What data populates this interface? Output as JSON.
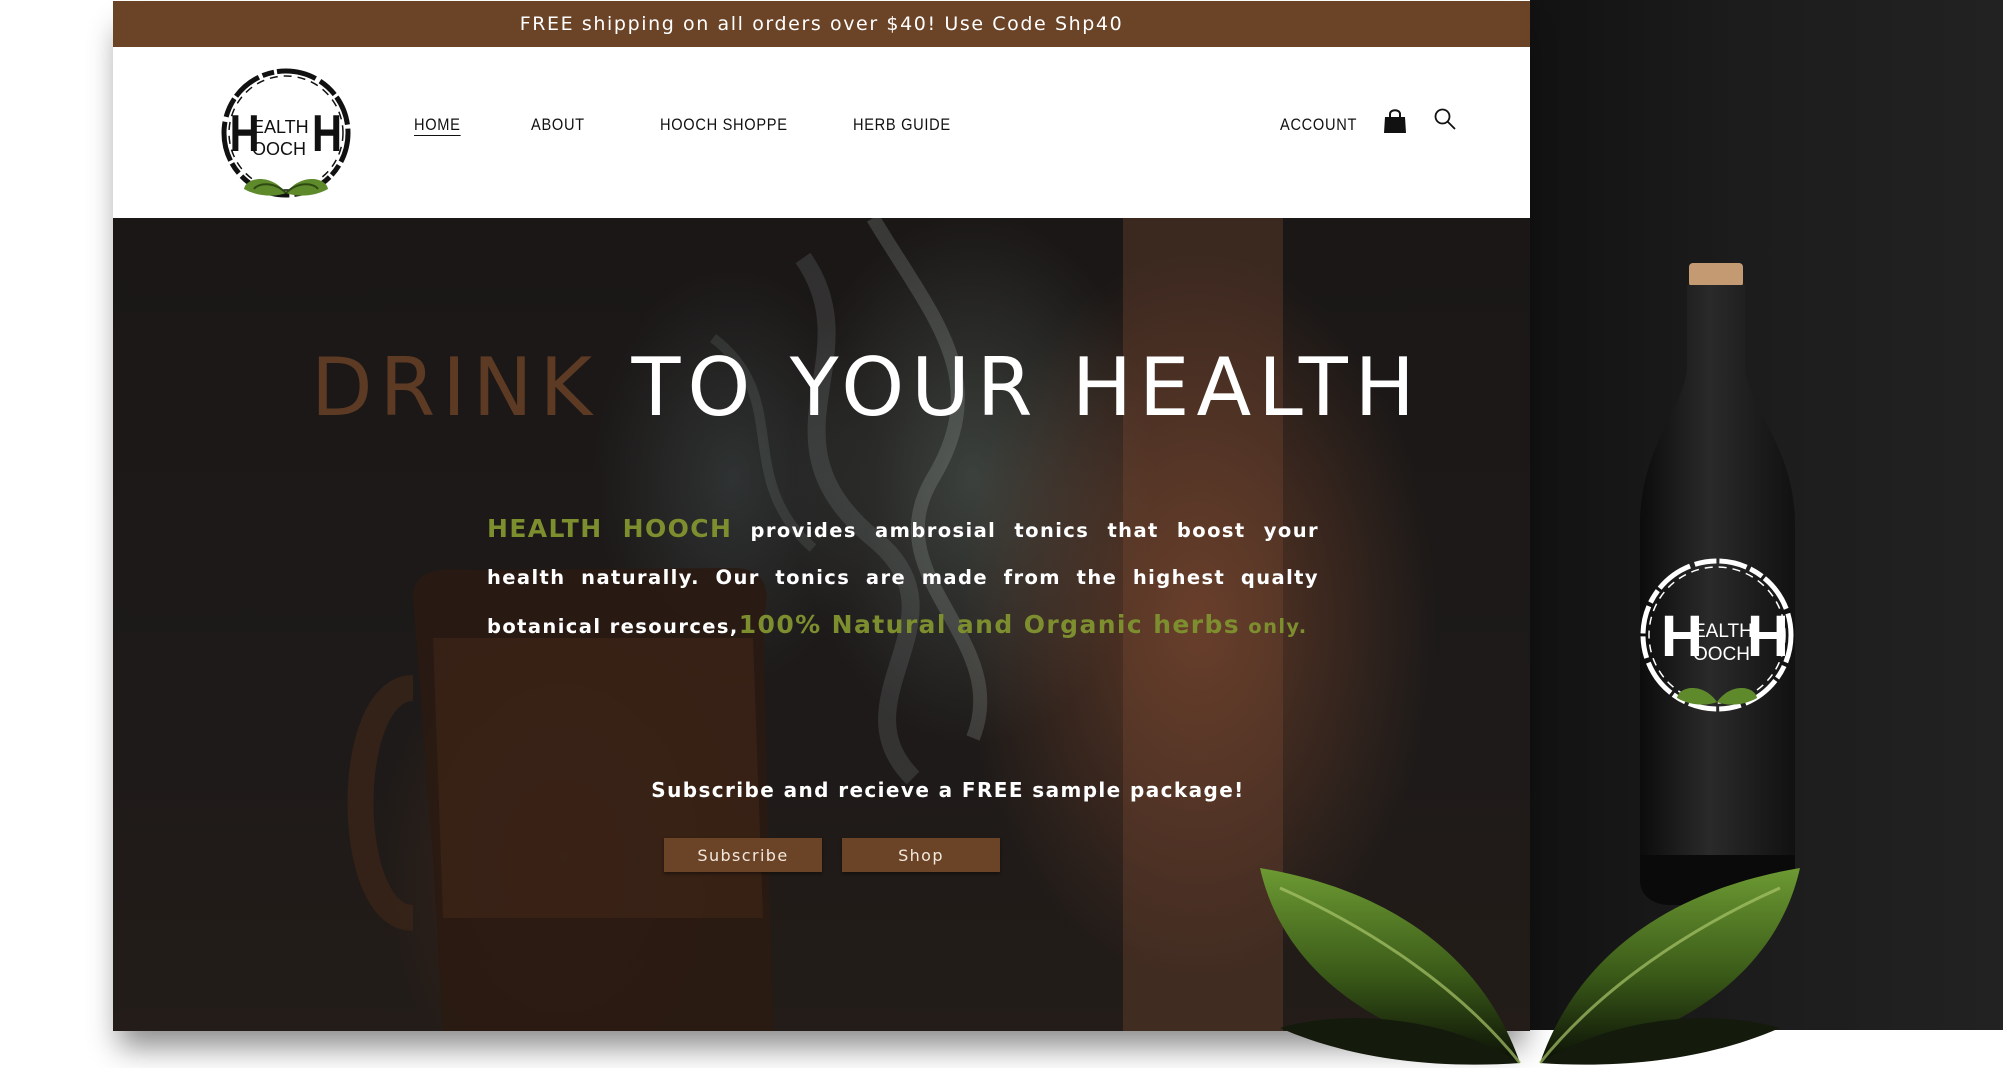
{
  "promo": {
    "text": "FREE shipping on all orders over $40! Use Code Shp40"
  },
  "brand": {
    "logo_text_top": "EALTH",
    "logo_text_bottom": "OOCH",
    "logo_letter": "H",
    "green": "#7d8e2f",
    "brown": "#6b4428"
  },
  "nav": {
    "items": [
      {
        "label": "HOME",
        "active": true
      },
      {
        "label": "ABOUT"
      },
      {
        "label": "HOOCH SHOPPE"
      },
      {
        "label": "HERB GUIDE"
      }
    ],
    "account_label": "ACCOUNT",
    "cart_icon": "shopping-bag-icon",
    "search_icon": "search-icon"
  },
  "hero": {
    "title_part1": "DRINK",
    "title_part2": "TO YOUR HEALTH",
    "body": {
      "brand": "HEALTH HOOCH",
      "text1": " provides ambrosial tonics that boost your health naturally. Our tonics are made from the highest qualty botanical resources,",
      "highlight": "100% Natural and Organic herbs",
      "tail": " only."
    },
    "subscribe_text": "Subscribe and recieve a FREE sample package!",
    "subscribe_button": "Subscribe",
    "shop_button": "Shop"
  }
}
